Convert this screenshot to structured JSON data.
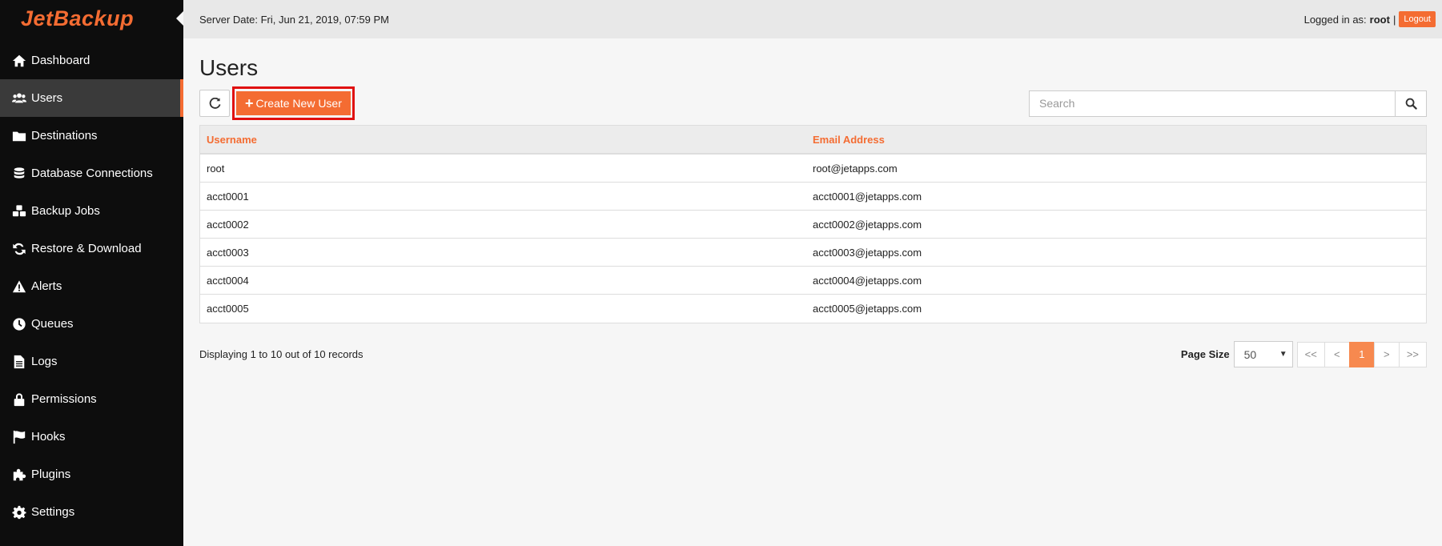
{
  "brand": {
    "logo_text": "JetBackup",
    "accent": "#f46c32"
  },
  "sidebar": {
    "items": [
      {
        "label": "Dashboard",
        "icon": "home-icon",
        "active": false
      },
      {
        "label": "Users",
        "icon": "users-icon",
        "active": true
      },
      {
        "label": "Destinations",
        "icon": "folder-icon",
        "active": false
      },
      {
        "label": "Database Connections",
        "icon": "database-icon",
        "active": false
      },
      {
        "label": "Backup Jobs",
        "icon": "cubes-icon",
        "active": false
      },
      {
        "label": "Restore & Download",
        "icon": "refresh-icon",
        "active": false
      },
      {
        "label": "Alerts",
        "icon": "warning-icon",
        "active": false
      },
      {
        "label": "Queues",
        "icon": "clock-icon",
        "active": false
      },
      {
        "label": "Logs",
        "icon": "file-icon",
        "active": false
      },
      {
        "label": "Permissions",
        "icon": "lock-icon",
        "active": false
      },
      {
        "label": "Hooks",
        "icon": "flag-icon",
        "active": false
      },
      {
        "label": "Plugins",
        "icon": "puzzle-icon",
        "active": false
      },
      {
        "label": "Settings",
        "icon": "gear-icon",
        "active": false
      }
    ]
  },
  "topbar": {
    "server_date": "Server Date: Fri, Jun 21, 2019, 07:59 PM",
    "logged_in_label": "Logged in as:",
    "username": "root",
    "separator": "|",
    "logout_label": "Logout"
  },
  "page": {
    "title": "Users",
    "create_label": "Create New User",
    "search_placeholder": "Search"
  },
  "table": {
    "headers": {
      "username": "Username",
      "email": "Email Address"
    },
    "rows": [
      {
        "username": "root",
        "email": "root@jetapps.com"
      },
      {
        "username": "acct0001",
        "email": "acct0001@jetapps.com"
      },
      {
        "username": "acct0002",
        "email": "acct0002@jetapps.com"
      },
      {
        "username": "acct0003",
        "email": "acct0003@jetapps.com"
      },
      {
        "username": "acct0004",
        "email": "acct0004@jetapps.com"
      },
      {
        "username": "acct0005",
        "email": "acct0005@jetapps.com"
      }
    ]
  },
  "footer": {
    "records_text": "Displaying 1 to 10 out of 10 records",
    "page_size_label": "Page Size",
    "page_size_value": "50",
    "pager": {
      "first": "<<",
      "prev": "<",
      "current": "1",
      "next": ">",
      "last": ">>"
    }
  }
}
